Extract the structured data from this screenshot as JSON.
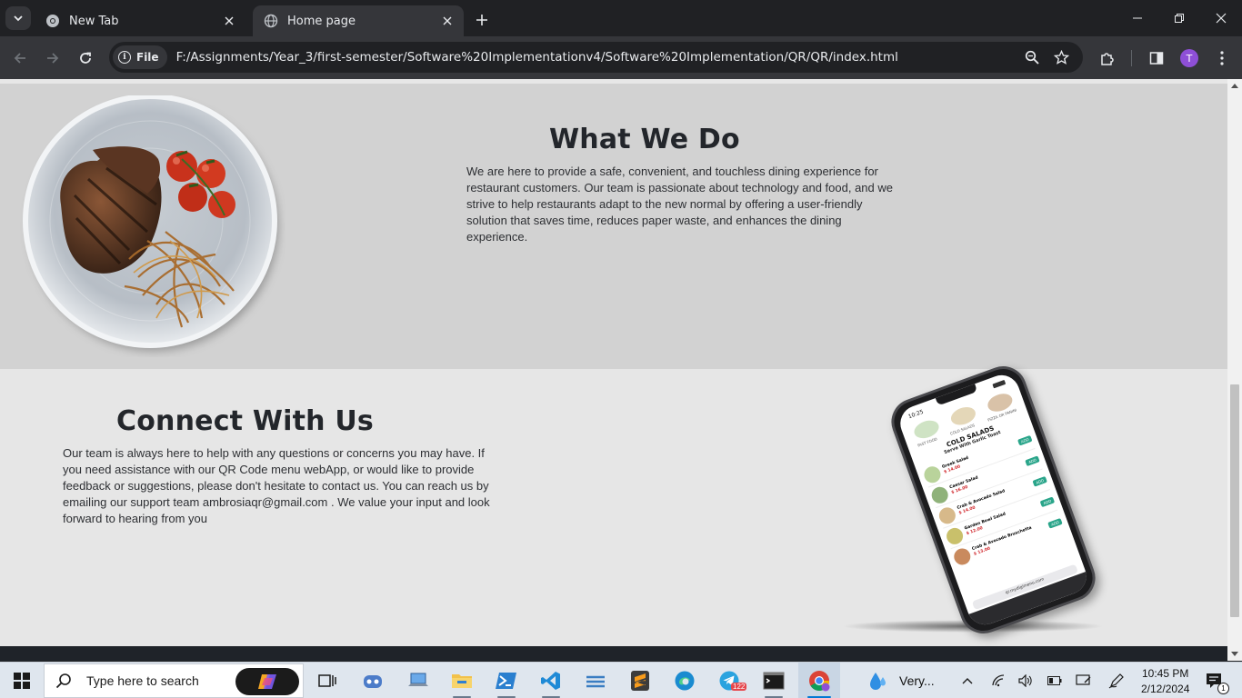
{
  "browser": {
    "tabs": [
      {
        "title": "New Tab",
        "active": false
      },
      {
        "title": "Home page",
        "active": true
      }
    ],
    "address": {
      "chip_label": "File",
      "url": "F:/Assignments/Year_3/first-semester/Software%20Implementationv4/Software%20Implementation/QR/QR/index.html"
    },
    "profile_initial": "T"
  },
  "page": {
    "what_we_do": {
      "heading": "What We Do",
      "body": "We are here to provide a safe, convenient, and touchless dining experience for restaurant customers. Our team is passionate about technology and food, and we strive to help restaurants adapt to the new normal by offering a user-friendly solution that saves time, reduces paper waste, and enhances the dining experience."
    },
    "connect": {
      "heading": "Connect With Us",
      "body": "Our team is always here to help with any questions or concerns you may have. If you need assistance with our QR Code menu webApp, or would like to provide feedback or suggestions, please don't hesitate to contact us. You can reach us by emailing our support team ambrosiaqr@gmail.com . We value your input and look forward to hearing from you"
    },
    "phone_screen": {
      "time": "10:25",
      "title": "COLD SALADS",
      "subtitle": "Serve With Garlic Toast",
      "categories": [
        "FAST FOOD",
        "COLD SALADS",
        "PIZZA OR PANINI"
      ],
      "items": [
        {
          "name": "Greek Salad",
          "price": "$ 14.00",
          "button": "ADD"
        },
        {
          "name": "Caesar Salad",
          "price": "$ 16.00",
          "button": "ADD"
        },
        {
          "name": "Crab & Avocado Salad",
          "price": "$ 14.00",
          "button": "ADD"
        },
        {
          "name": "Garden Bowl Salad",
          "price": "$ 12.00",
          "button": "ADD"
        },
        {
          "name": "Crab & Avocado Bruschetta",
          "price": "$ 13.00",
          "button": "ADD"
        }
      ],
      "url_bar": "qr.mydigimenu.com"
    }
  },
  "taskbar": {
    "search_placeholder": "Type here to search",
    "weather_text": "Very...",
    "telegram_badge": "122",
    "time": "10:45 PM",
    "date": "2/12/2024",
    "notification_count": "1",
    "colors": {
      "taskbar_bg": "#dfe6ee",
      "accent": "#0078d4"
    }
  }
}
